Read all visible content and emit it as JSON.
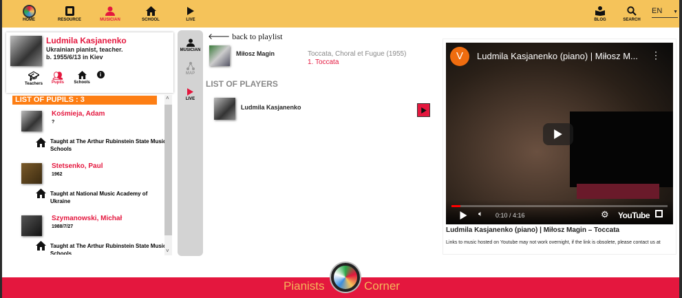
{
  "header": {
    "nav": [
      {
        "label": "HOME",
        "icon": "logo-icon"
      },
      {
        "label": "RESOURCE",
        "icon": "library-icon"
      },
      {
        "label": "MUSICIAN",
        "icon": "person-icon",
        "active": true
      },
      {
        "label": "SCHOOL",
        "icon": "house-icon"
      },
      {
        "label": "LIVE",
        "icon": "play-icon"
      }
    ],
    "right": [
      {
        "label": "BLOG",
        "icon": "book-reader-icon"
      },
      {
        "label": "SEARCH",
        "icon": "search-icon"
      }
    ],
    "language": "EN"
  },
  "profile": {
    "name": "Ludmila Kasjanenko",
    "desc": "Ukrainian pianist, teacher.",
    "born": "b. 1955/6/13 in Kiev",
    "tabs": [
      "Teachers",
      "Pupils",
      "Schools"
    ]
  },
  "pupils": {
    "header": "LIST OF PUPILS : 3",
    "items": [
      {
        "name": "Kośmieja, Adam",
        "year": "?",
        "taught": "Taught at The Arthur Rubinstein State Music Schools"
      },
      {
        "name": "Stetsenko, Paul",
        "year": "1962",
        "taught": "Taught at National Music Academy of Ukraine"
      },
      {
        "name": "Szymanowski, Michał",
        "year": "1988/7/27",
        "taught": "Taught at The Arthur Rubinstein State Music Schools"
      }
    ]
  },
  "sidenav": [
    "MUSICIAN",
    "MAP",
    "LIVE"
  ],
  "middle": {
    "back": "back to playlist",
    "composer": "Miłosz Magin",
    "work": "Toccata, Choral et Fugue (1955)",
    "movement": "1. Toccata",
    "players_header": "LIST OF PLAYERS",
    "players": [
      "Ludmila Kasjanenko"
    ]
  },
  "video": {
    "channel_initial": "V",
    "title": "Ludmila Kasjanenko (piano) | Miłosz M...",
    "time": "0:10 / 4:16",
    "progress": 0.04,
    "brand": "YouTube",
    "caption": "Ludmila Kasjanenko (piano) | Miłosz Magin – Toccata",
    "note": "Links to music hosted on Youtube may not work overnight, if the link is obsolete, please contact us at"
  },
  "footer": {
    "left": "Pianists",
    "right": "Corner"
  },
  "colors": {
    "header": "#f5c35a",
    "accent": "#e4173e",
    "orange": "#fd7e14"
  }
}
